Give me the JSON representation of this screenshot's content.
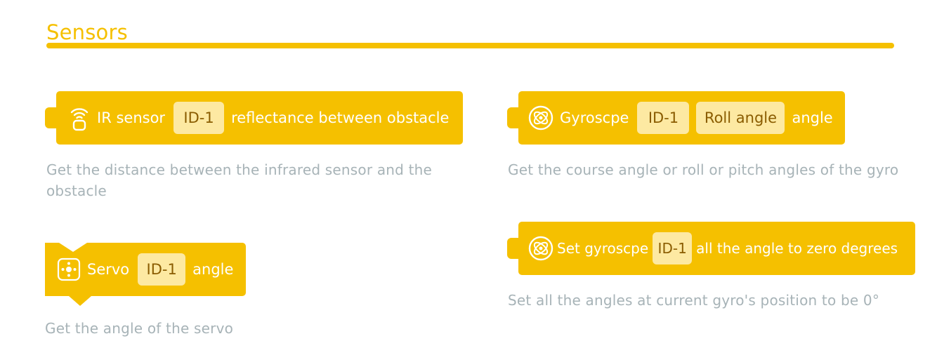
{
  "section": {
    "title": "Sensors"
  },
  "colors": {
    "accent": "#f5c000",
    "field_bg": "#fde9a2",
    "field_text": "#8a5c00",
    "description": "#a7b3b7"
  },
  "ir_block": {
    "icon": "ir-sensor-icon",
    "label": "IR sensor",
    "id_field": "ID-1",
    "suffix": "reflectance between obstacle",
    "description": "Get the distance between the infrared sensor and the obstacle"
  },
  "gyro_block": {
    "icon": "gyroscope-icon",
    "label": "Gyroscpe",
    "id_field": "ID-1",
    "angle_field": "Roll angle",
    "suffix": "angle",
    "description": "Get the course angle or roll or pitch angles of the gyro"
  },
  "servo_block": {
    "icon": "servo-icon",
    "label": "Servo",
    "id_field": "ID-1",
    "suffix": "angle",
    "description": "Get the angle of the servo"
  },
  "gyro_reset_block": {
    "icon": "gyroscope-icon",
    "label": "Set gyroscpe",
    "id_field": "ID-1",
    "suffix": "all the angle to zero degrees",
    "description": "Set all the angles at current gyro's position to be 0°"
  }
}
